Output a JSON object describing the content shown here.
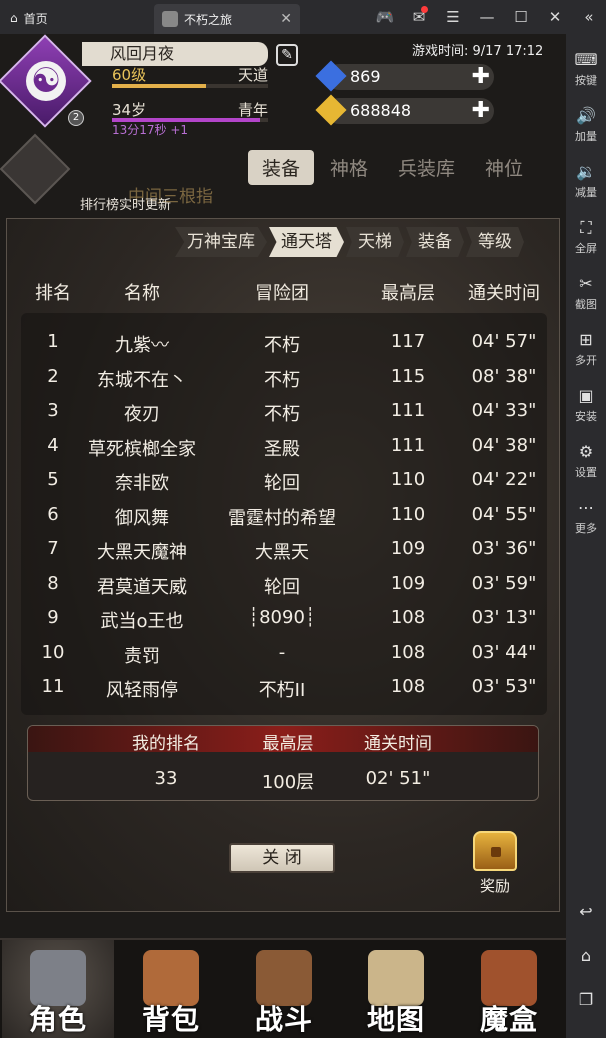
{
  "emulator": {
    "home_tab": "首页",
    "game_tab": "不朽之旅",
    "tab_close": "✕",
    "controls": [
      "🎮",
      "✉",
      "☰",
      "—",
      "☐",
      "✕",
      "«"
    ]
  },
  "sidebar": {
    "items": [
      {
        "icon": "keyboard-icon",
        "glyph": "⌨",
        "label": "按键"
      },
      {
        "icon": "volume-up-icon",
        "glyph": "🔊",
        "label": "加量"
      },
      {
        "icon": "volume-down-icon",
        "glyph": "🔉",
        "label": "减量"
      },
      {
        "icon": "fullscreen-icon",
        "glyph": "⛶",
        "label": "全屏"
      },
      {
        "icon": "scissors-icon",
        "glyph": "✂",
        "label": "截图"
      },
      {
        "icon": "multi-open-icon",
        "glyph": "⊞",
        "label": "多开"
      },
      {
        "icon": "apk-icon",
        "glyph": "▣",
        "label": "安装"
      },
      {
        "icon": "gear-icon",
        "glyph": "⚙",
        "label": "设置"
      },
      {
        "icon": "more-icon",
        "glyph": "⋯",
        "label": "更多"
      }
    ],
    "nav": {
      "back": "↩",
      "home": "⌂",
      "recent": "❐"
    }
  },
  "player": {
    "name": "风回月夜",
    "level": "60级",
    "realm": "天道",
    "level_progress": 0.6,
    "age": "34岁",
    "age_stage": "青年",
    "age_progress": 0.95,
    "timer": "13分17秒 +1",
    "avatar_badge": "2",
    "avatar_glyph": "☯",
    "edit_glyph": "✎"
  },
  "game_time": "游戏时间: 9/17 17:12",
  "resources": {
    "diamond": {
      "value": "869",
      "color": "#3b6fe0"
    },
    "gold": {
      "value": "688848",
      "color": "#e7b733"
    },
    "plus": "✚"
  },
  "background": {
    "tabs": [
      "装备",
      "神格",
      "兵装库",
      "神位"
    ],
    "active_tab": 0,
    "title": "中间三根指",
    "note": "排行榜实时更新"
  },
  "ranking": {
    "tabs": [
      "万神宝库",
      "通天塔",
      "天梯",
      "装备",
      "等级"
    ],
    "active_tab": 1,
    "headers": {
      "rank": "排名",
      "name": "名称",
      "team": "冒险团",
      "floor": "最高层",
      "time": "通关时间"
    },
    "rows": [
      {
        "rank": "1",
        "name": "九紫〰",
        "team": "不朽",
        "floor": "117",
        "time": "04' 57\""
      },
      {
        "rank": "2",
        "name": "东城不在丶",
        "team": "不朽",
        "floor": "115",
        "time": "08' 38\""
      },
      {
        "rank": "3",
        "name": "夜刃",
        "team": "不朽",
        "floor": "111",
        "time": "04' 33\""
      },
      {
        "rank": "4",
        "name": "草死槟榔全家",
        "team": "圣殿",
        "floor": "111",
        "time": "04' 38\""
      },
      {
        "rank": "5",
        "name": "奈非欧",
        "team": "轮回",
        "floor": "110",
        "time": "04' 22\""
      },
      {
        "rank": "6",
        "name": "御风舞",
        "team": "雷霆村的希望",
        "floor": "110",
        "time": "04' 55\""
      },
      {
        "rank": "7",
        "name": "大黑天魔神",
        "team": "大黑天",
        "floor": "109",
        "time": "03' 36\""
      },
      {
        "rank": "8",
        "name": "君莫道天威",
        "team": "轮回",
        "floor": "109",
        "time": "03' 59\""
      },
      {
        "rank": "9",
        "name": "武当o王也",
        "team": "┊8090┊",
        "floor": "108",
        "time": "03' 13\""
      },
      {
        "rank": "10",
        "name": "责罚",
        "team": "-",
        "floor": "108",
        "time": "03' 44\""
      },
      {
        "rank": "11",
        "name": "风轻雨停",
        "team": "不朽II",
        "floor": "108",
        "time": "03' 53\""
      }
    ],
    "my": {
      "headers": {
        "rank": "我的排名",
        "floor": "最高层",
        "time": "通关时间"
      },
      "rank": "33",
      "floor": "100层",
      "time": "02' 51\""
    },
    "close_label": "关 闭",
    "reward_label": "奖励"
  },
  "bottom_nav": [
    {
      "label": "角色",
      "icon": "helmet-icon",
      "color": "#7d8088"
    },
    {
      "label": "背包",
      "icon": "backpack-icon",
      "color": "#b06a3a"
    },
    {
      "label": "战斗",
      "icon": "sword-shield-icon",
      "color": "#8a5a36"
    },
    {
      "label": "地图",
      "icon": "scroll-map-icon",
      "color": "#cbb58a"
    },
    {
      "label": "魔盒",
      "icon": "magic-box-icon",
      "color": "#a0522d"
    }
  ],
  "bottom_nav_active": 0
}
